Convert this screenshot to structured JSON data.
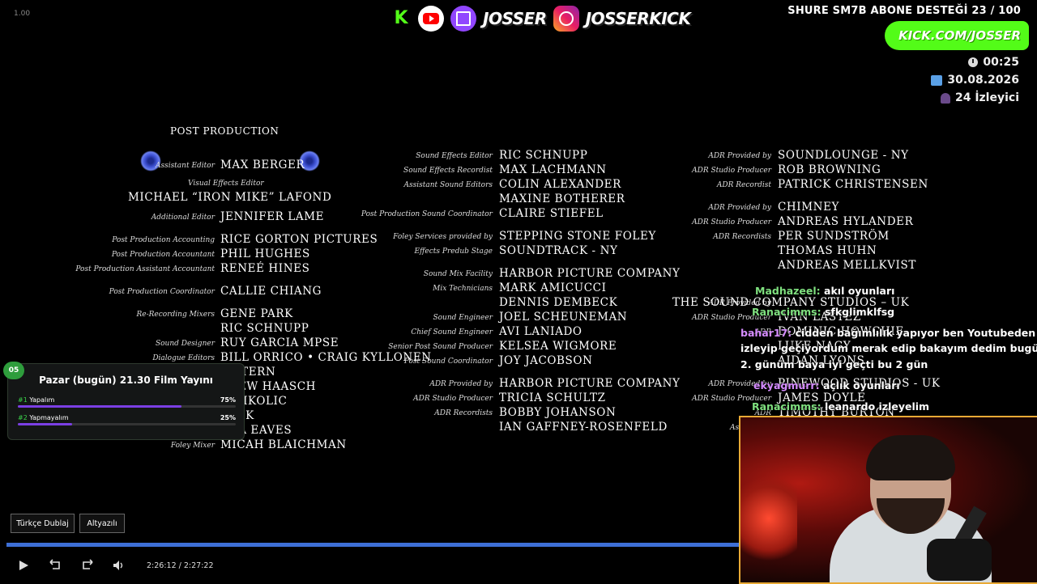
{
  "overlay": {
    "version": "1.00",
    "brand_twitch": "JOSSER",
    "brand_instagram": "JOSSERKICK",
    "goal": "SHURE SM7B ABONE DESTEĞİ 23 / 100",
    "kick_url": "KICK.COM/JOSSER",
    "clock": "00:25",
    "date": "30.08.2026",
    "viewers": "24 İzleyici",
    "icons": [
      "kick-icon",
      "youtube-icon",
      "twitch-icon",
      "instagram-icon",
      "clock-icon",
      "calendar-icon",
      "user-icon"
    ]
  },
  "credits": {
    "section": "POST PRODUCTION",
    "col1": [
      {
        "role": "Assistant Editor",
        "name": "MAX BERGER"
      },
      {
        "role": "Visual Effects Editor",
        "name": "MICHAEL “IRON MIKE” LAFOND"
      },
      {
        "role": "Additional Editor",
        "name": "JENNIFER LAME"
      },
      {
        "role": "Post Production Accounting",
        "name": "RICE GORTON PICTURES"
      },
      {
        "role": "Post Production Accountant",
        "name": "PHIL HUGHES"
      },
      {
        "role": "Post Production Assistant Accountant",
        "name": "RENEÉ HINES"
      },
      {
        "role": "Post Production Coordinator",
        "name": "CALLIE CHIANG"
      },
      {
        "role": "Re-Recording Mixers",
        "name": "GENE PARK"
      },
      {
        "role": "",
        "name": "RIC SCHNUPP"
      },
      {
        "role": "Sound Designer",
        "name": "RUY GARCIA MPSE"
      },
      {
        "role": "Dialogue Editors",
        "name": "BILL ORRICO • CRAIG KYLLONEN"
      },
      {
        "role": "",
        "name": "A STERN"
      },
      {
        "role": "",
        "name": "THEW HAASCH"
      },
      {
        "role": "",
        "name": "R NIKOLIC"
      },
      {
        "role": "",
        "name": "PECK"
      },
      {
        "role": "",
        "name": "DRA EAVES"
      },
      {
        "role": "Foley Mixer",
        "name": "MICAH BLAICHMAN"
      }
    ],
    "col2": [
      {
        "role": "Sound Effects Editor",
        "name": "RIC SCHNUPP"
      },
      {
        "role": "Sound Effects Recordist",
        "name": "MAX LACHMANN"
      },
      {
        "role": "Assistant Sound Editors",
        "name": "COLIN ALEXANDER"
      },
      {
        "role": "",
        "name": "MAXINE BOTHERER"
      },
      {
        "role": "Post Production Sound Coordinator",
        "name": "CLAIRE STIEFEL"
      },
      {
        "role": "Foley Services provided by",
        "name": "STEPPING STONE FOLEY"
      },
      {
        "role": "Effects Predub Stage",
        "name": "SOUNDTRACK - NY"
      },
      {
        "role": "Sound Mix Facility",
        "name": "HARBOR PICTURE COMPANY"
      },
      {
        "role": "Mix Technicians",
        "name": "MARK AMICUCCI"
      },
      {
        "role": "",
        "name": "DENNIS DEMBECK"
      },
      {
        "role": "Sound Engineer",
        "name": "JOEL SCHEUNEMAN"
      },
      {
        "role": "Chief Sound Engineer",
        "name": "AVI LANIADO"
      },
      {
        "role": "Senior Post Sound Producer",
        "name": "KELSEA WIGMORE"
      },
      {
        "role": "Post Sound Coordinator",
        "name": "JOY JACOBSON"
      },
      {
        "role": "ADR Provided by",
        "name": "HARBOR PICTURE COMPANY"
      },
      {
        "role": "ADR Studio Producer",
        "name": "TRICIA SCHULTZ"
      },
      {
        "role": "ADR Recordists",
        "name": "BOBBY JOHANSON"
      },
      {
        "role": "",
        "name": "IAN GAFFNEY-ROSENFELD"
      }
    ],
    "col3": [
      {
        "role": "ADR Provided by",
        "name": "SOUNDLOUNGE - NY"
      },
      {
        "role": "ADR Studio Producer",
        "name": "ROB BROWNING"
      },
      {
        "role": "ADR Recordist",
        "name": "PATRICK CHRISTENSEN"
      },
      {
        "role": "ADR Provided by",
        "name": "CHIMNEY"
      },
      {
        "role": "ADR Studio Producer",
        "name": "ANDREAS HYLANDER"
      },
      {
        "role": "ADR Recordists",
        "name": "PER SUNDSTRÖM"
      },
      {
        "role": "",
        "name": "THOMAS HUHN"
      },
      {
        "role": "",
        "name": "ANDREAS MELLKVIST"
      },
      {
        "role": "ADR Provided by",
        "name": "THE SOUND COMPANY STUDIOS – UK"
      },
      {
        "role": "ADR Studio Producer",
        "name": "IVAN LASTEZ"
      },
      {
        "role": "ADR",
        "name": "DOMINIC HOWCHIE"
      },
      {
        "role": "",
        "name": "LUKE NAGY"
      },
      {
        "role": "",
        "name": "AIDAN LYONS"
      },
      {
        "role": "ADR Provided by",
        "name": "PINEWOOD STUDIOS - UK"
      },
      {
        "role": "ADR Studio Producer",
        "name": "JAMES DOYLE"
      },
      {
        "role": "ADR",
        "name": "TIMOTHY BURTON"
      },
      {
        "role": "Assistant A",
        "name": ""
      }
    ]
  },
  "chat": [
    {
      "user": "Madhazeel:",
      "text": "akıl oyunları"
    },
    {
      "user": "Ranacimms:",
      "text": "sfkglimklfsg"
    },
    {
      "user": "bahar17:",
      "text": "cidden bağımlılık yapıyor ben Youtubeden"
    },
    {
      "user": "",
      "text": "izleyip geçiyordum merak edip bakayım dedim bugün"
    },
    {
      "user": "",
      "text": "2. günüm baya iyi geçti bu 2 gün"
    },
    {
      "user": "ekyagmurr:",
      "text": "açlık oyunları"
    },
    {
      "user": "Ranacimms:",
      "text": "leanardo izleyelim"
    }
  ],
  "poll": {
    "badge": "05",
    "title": "Pazar (bugün) 21.30 Film Yayını",
    "options": [
      {
        "num": "#1",
        "label": "Yapalım",
        "percent": "75%",
        "value": 75
      },
      {
        "num": "#2",
        "label": "Yapmayalım",
        "percent": "25%",
        "value": 25
      }
    ]
  },
  "player": {
    "dub_button": "Türkçe Dublaj",
    "sub_button": "Altyazılı",
    "current_time": "2:26:12",
    "separator": "/",
    "duration": "2:27:22",
    "progress": 0.992,
    "icons": [
      "play-icon",
      "rewind-10-icon",
      "forward-10-icon",
      "volume-icon"
    ]
  }
}
